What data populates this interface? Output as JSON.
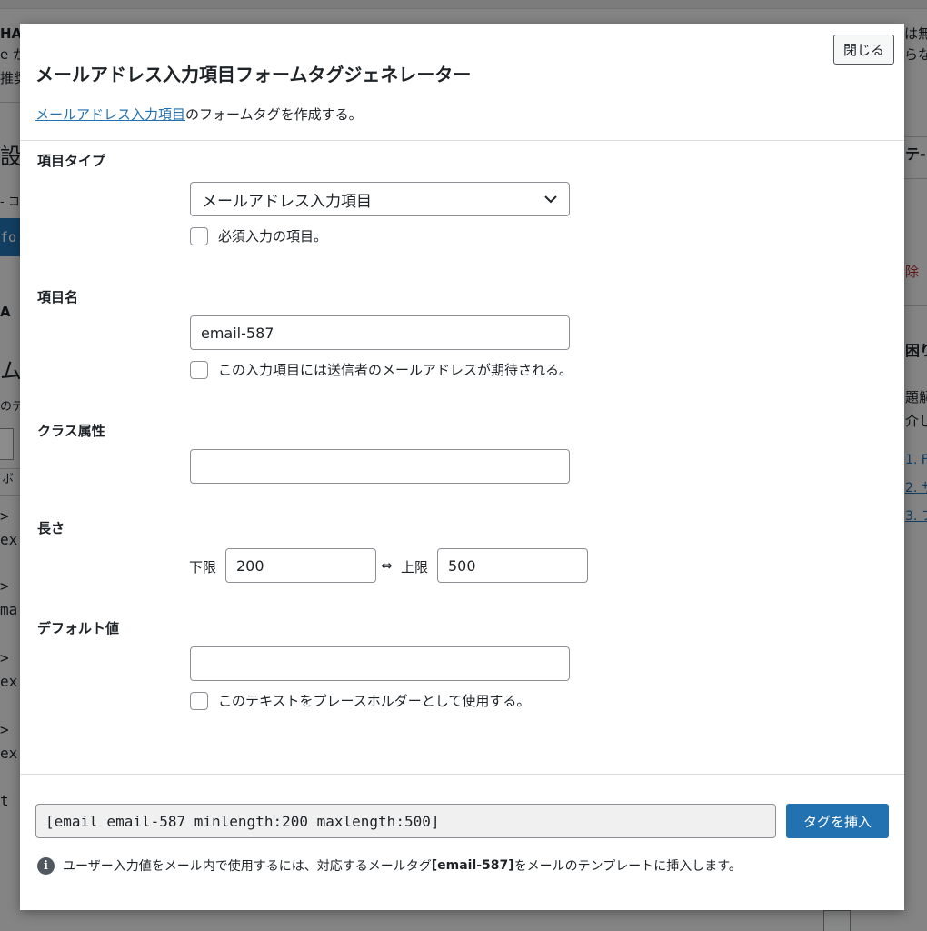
{
  "modal": {
    "title": "メールアドレス入力項目フォームタグジェネレーター",
    "close_label": "閉じる",
    "intro_link": "メールアドレス入力項目",
    "intro_text": "のフォームタグを作成する。"
  },
  "fields": {
    "type": {
      "label": "項目タイプ",
      "selected": "メールアドレス入力項目",
      "required_label": "必須入力の項目。"
    },
    "name": {
      "label": "項目名",
      "value": "email-587",
      "sender_label": "この入力項目には送信者のメールアドレスが期待される。"
    },
    "class": {
      "label": "クラス属性",
      "value": ""
    },
    "length": {
      "label": "長さ",
      "min_label": "下限",
      "min_value": "200",
      "separator": "⇔",
      "max_label": "上限",
      "max_value": "500"
    },
    "default": {
      "label": "デフォルト値",
      "value": "",
      "placeholder_label": "このテキストをプレースホルダーとして使用する。"
    }
  },
  "footer": {
    "tag_output": "[email email-587 minlength:200 maxlength:500]",
    "insert_label": "タグを挿入",
    "note_before": "ユーザー入力値をメール内で使用するには、対応するメールタグ ",
    "note_tag": "[email-587]",
    "note_after": " をメールのテンプレートに挿入します。"
  },
  "background": {
    "frag_ha": "HA",
    "frag_ka": "e か",
    "frag_sui": "推奨",
    "frag_settei": "設",
    "frag_co": "- コ",
    "frag_fo": "fo",
    "frag_a": "A",
    "frag_mu": "ム",
    "frag_node": "のデ",
    "frag_bo": "ボ",
    "frag_gt1": ">",
    "frag_ex1": "ex",
    "frag_gt2": ">",
    "frag_ma": "ma",
    "frag_gt3": ">",
    "frag_ex2": "ex",
    "frag_gt4": ">",
    "frag_ex3": "ex",
    "frag_t": "t",
    "frag_wamu": "は無",
    "frag_rana": "らな",
    "frag_te": "テ-",
    "frag_jo": "除",
    "frag_komari": "困り",
    "frag_dai": "題解",
    "frag_kai": "介し",
    "frag_l1": "1. F",
    "frag_l2": "2. サ",
    "frag_l3": "3. フ"
  },
  "colors": {
    "accent": "#2271b1",
    "delete": "#b32d2e"
  }
}
